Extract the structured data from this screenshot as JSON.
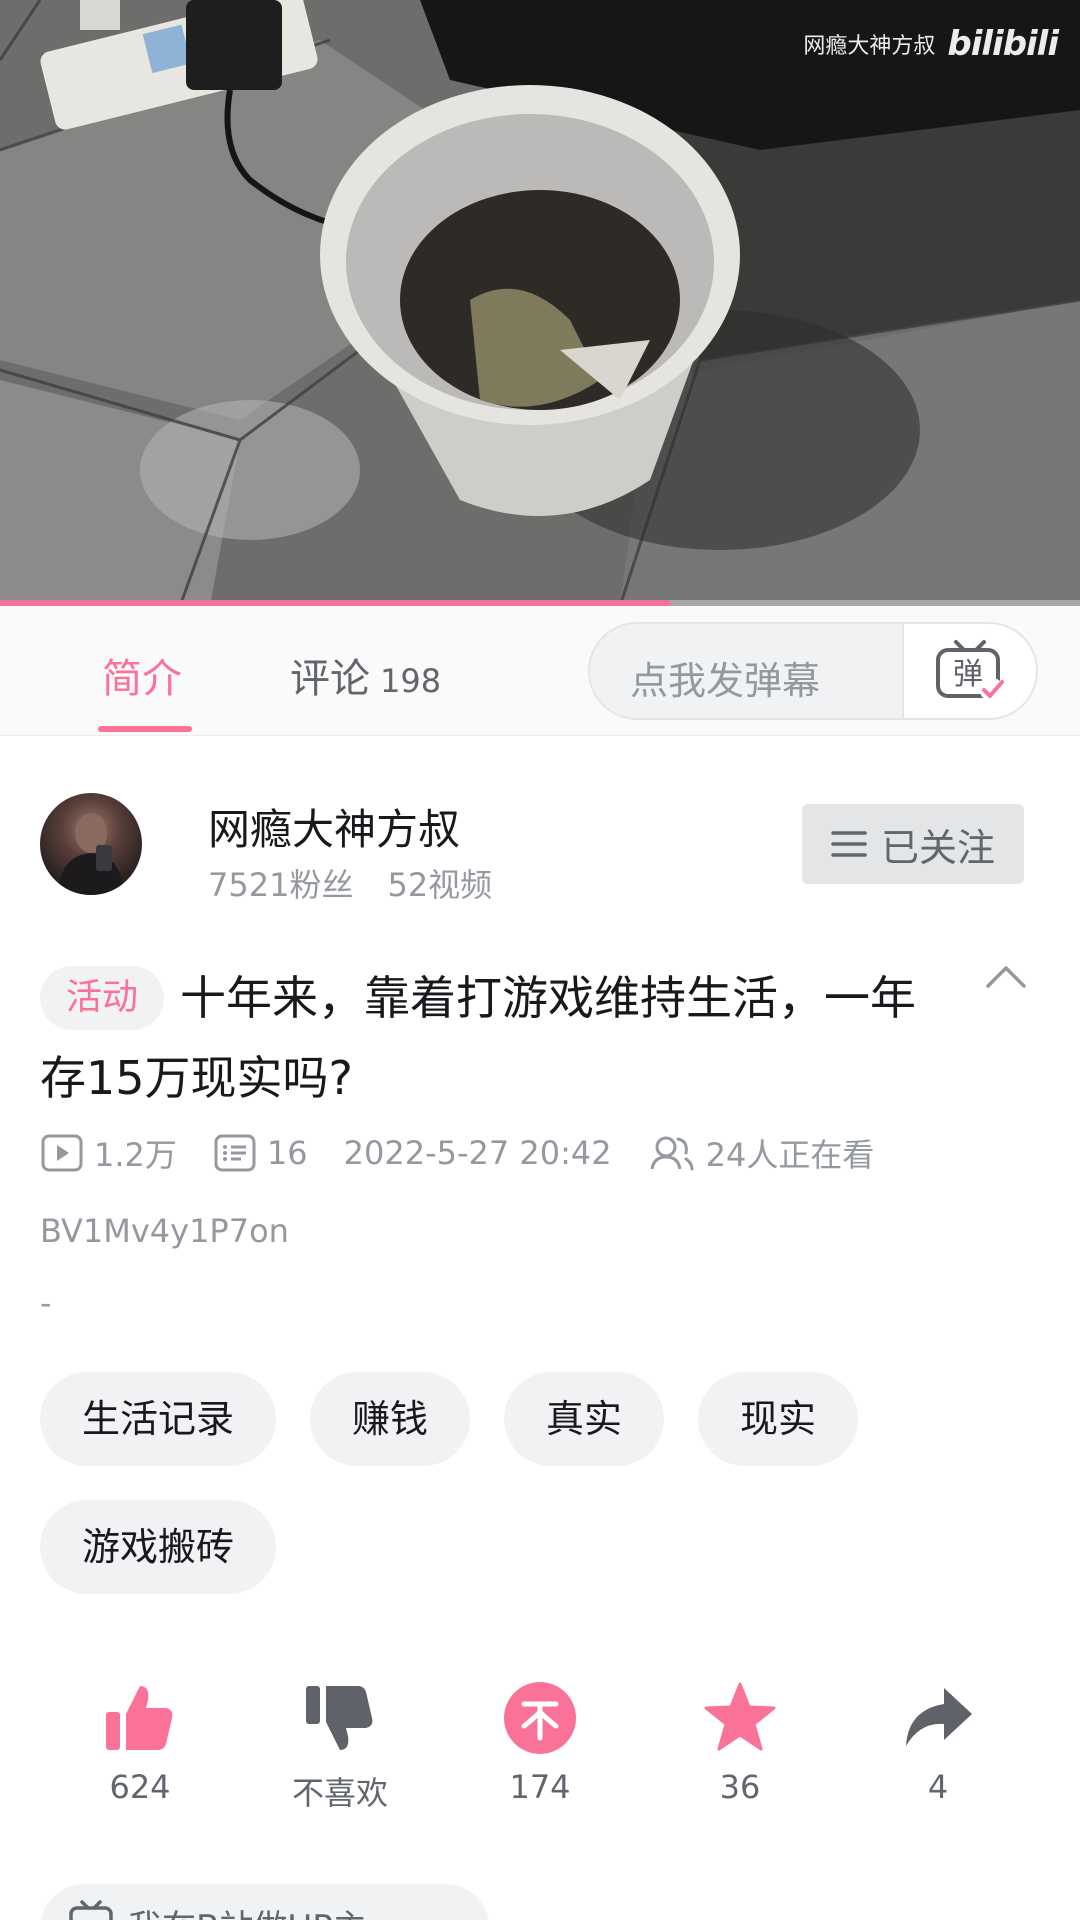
{
  "video": {
    "watermark_name": "网瘾大神方叔",
    "watermark_logo": "bilibili",
    "progress_fraction": 0.62,
    "accent_color": "#f0729a"
  },
  "tabs": {
    "intro_label": "简介",
    "comment_label": "评论",
    "comment_count": "198",
    "active": "intro"
  },
  "danmaku": {
    "placeholder": "点我发弹幕",
    "button_icon": "danmaku-tv-icon",
    "button_glyph": "弹"
  },
  "uploader": {
    "name": "网瘾大神方叔",
    "fans": "7521粉丝",
    "videos": "52视频",
    "follow_label": "已关注",
    "follow_icon": "menu-lines-icon"
  },
  "video_info": {
    "badge": "活动",
    "title": "十年来，靠着打游戏维持生活，一年存15万现实吗?",
    "plays": "1.2万",
    "danmaku_count": "16",
    "date": "2022-5-27 20:42",
    "watching": "24人正在看",
    "bvid": "BV1Mv4y1P7on",
    "description": "-"
  },
  "tags": [
    "生活记录",
    "赚钱",
    "真实",
    "现实",
    "游戏搬砖"
  ],
  "actions": {
    "like": "624",
    "dislike": "不喜欢",
    "coin": "174",
    "favorite": "36",
    "share": "4"
  },
  "bottom_pill": {
    "label": "我在B站做UP主"
  },
  "colors": {
    "brand_pink": "#fb7299",
    "text_primary": "#18191c",
    "text_secondary": "#61666d",
    "text_muted": "#9499a0",
    "icon_dark": "#5f6369"
  }
}
